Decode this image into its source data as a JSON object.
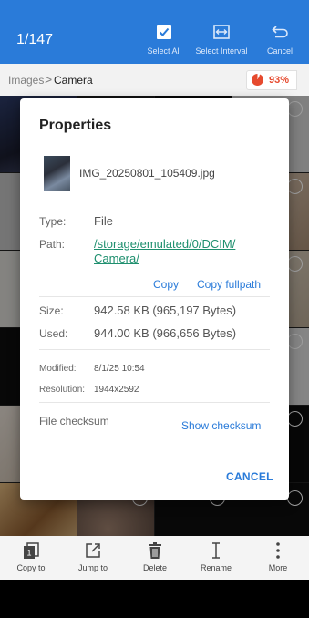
{
  "topbar": {
    "counter": "1/147",
    "select_all": "Select All",
    "select_interval": "Select Interval",
    "cancel": "Cancel"
  },
  "pathbar": {
    "crumb_root": "Images",
    "separator": ">",
    "crumb_current": "Camera",
    "storage_percent": "93%",
    "storage_fraction": 0.93
  },
  "dialog": {
    "title": "Properties",
    "file_name": "IMG_20250801_105409.jpg",
    "type_label": "Type:",
    "type_value": "File",
    "path_label": "Path:",
    "path_line1": "/storage/emulated/0/DCIM/",
    "path_line2": "Camera/",
    "copy": "Copy",
    "copy_fullpath": "Copy fullpath",
    "size_label": "Size:",
    "size_value": "942.58 KB (965,197 Bytes)",
    "used_label": "Used:",
    "used_value": "944.00 KB (966,656 Bytes)",
    "modified_label": "Modified:",
    "modified_value": "8/1/25 10:54",
    "resolution_label": "Resolution:",
    "resolution_value": "1944x2592",
    "checksum_label": "File checksum",
    "show_checksum": "Show checksum",
    "cancel": "CANCEL"
  },
  "bottombar": {
    "copy_to": "Copy to",
    "jump_to": "Jump to",
    "delete": "Delete",
    "rename": "Rename",
    "more": "More"
  },
  "colors": {
    "accent": "#2a7bd9",
    "link": "#1e8f6e",
    "storage": "#e64a2e"
  },
  "icons": [
    "checkbox-icon",
    "interval-icon",
    "return-icon",
    "pie-icon",
    "copy-to-icon",
    "jump-to-icon",
    "trash-icon",
    "rename-cursor-icon",
    "more-vert-icon"
  ]
}
